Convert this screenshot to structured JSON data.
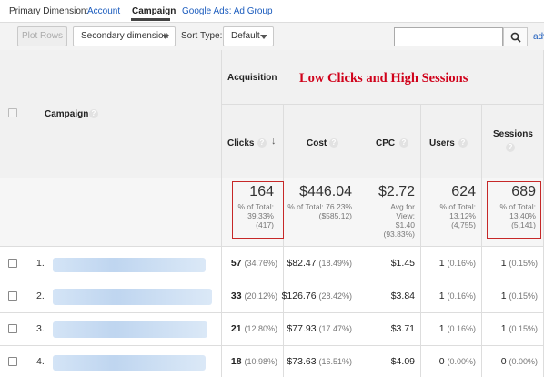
{
  "dimension_bar": {
    "label": "Primary Dimension:",
    "options": [
      "Account",
      "Campaign",
      "Google Ads: Ad Group"
    ],
    "selected": "Campaign"
  },
  "toolbar": {
    "plot_rows": "Plot Rows",
    "secondary_dimension": "Secondary dimension",
    "sort_type_label": "Sort Type:",
    "sort_type_value": "Default",
    "search_value": "",
    "advanced_link": "adv"
  },
  "annotation": "Low Clicks and High Sessions",
  "table": {
    "group_header": "Acquisition",
    "campaign_header": "Campaign",
    "columns": [
      "Clicks",
      "Cost",
      "CPC",
      "Users",
      "Sessions"
    ],
    "totals": {
      "clicks": {
        "value": "164",
        "line1": "% of Total:",
        "line2": "39.33%",
        "line3": "(417)"
      },
      "cost": {
        "value": "$446.04",
        "line1": "% of Total: 76.23%",
        "line2": "($585.12)",
        "line3": ""
      },
      "cpc": {
        "value": "$2.72",
        "line1": "Avg for",
        "line2": "View:",
        "line3": "$1.40",
        "line4": "(93.83%)"
      },
      "users": {
        "value": "624",
        "line1": "% of Total:",
        "line2": "13.12%",
        "line3": "(4,755)"
      },
      "sessions": {
        "value": "689",
        "line1": "% of Total:",
        "line2": "13.40%",
        "line3": "(5,141)"
      }
    },
    "rows": [
      {
        "num": "1.",
        "clicks": "57",
        "clicks_pct": "(34.76%)",
        "cost": "$82.47",
        "cost_pct": "(18.49%)",
        "cpc": "$1.45",
        "users": "1",
        "users_pct": "(0.16%)",
        "sessions": "1",
        "sessions_pct": "(0.15%)"
      },
      {
        "num": "2.",
        "clicks": "33",
        "clicks_pct": "(20.12%)",
        "cost": "$126.76",
        "cost_pct": "(28.42%)",
        "cpc": "$3.84",
        "users": "1",
        "users_pct": "(0.16%)",
        "sessions": "1",
        "sessions_pct": "(0.15%)"
      },
      {
        "num": "3.",
        "clicks": "21",
        "clicks_pct": "(12.80%)",
        "cost": "$77.93",
        "cost_pct": "(17.47%)",
        "cpc": "$3.71",
        "users": "1",
        "users_pct": "(0.16%)",
        "sessions": "1",
        "sessions_pct": "(0.15%)"
      },
      {
        "num": "4.",
        "clicks": "18",
        "clicks_pct": "(10.98%)",
        "cost": "$73.63",
        "cost_pct": "(16.51%)",
        "cpc": "$4.09",
        "users": "0",
        "users_pct": "(0.00%)",
        "sessions": "0",
        "sessions_pct": "(0.00%)"
      }
    ]
  },
  "colors": {
    "link": "#1a5bbd",
    "annotation": "#d0021b",
    "highlight_box": "#c62828"
  }
}
